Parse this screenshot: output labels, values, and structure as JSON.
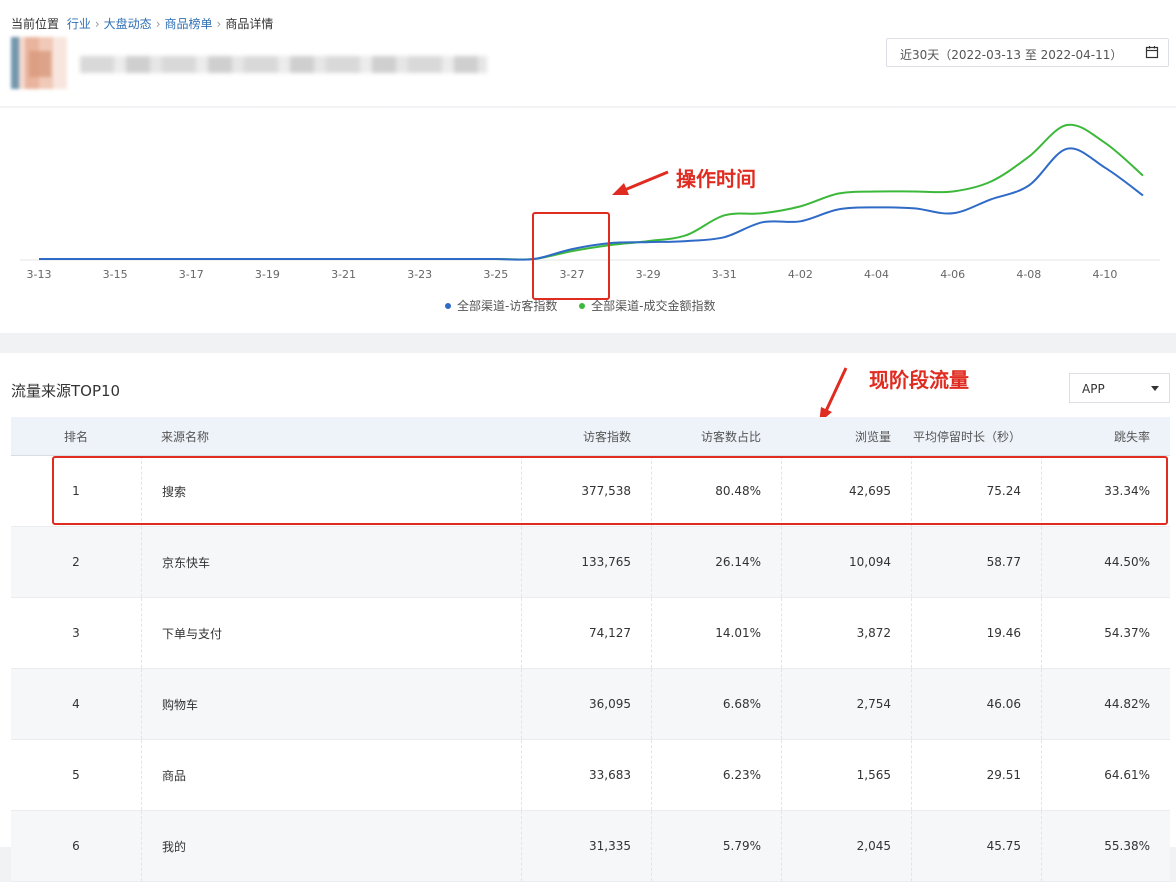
{
  "breadcrumb": {
    "prefix": "当前位置",
    "items": [
      "行业",
      "大盘动态",
      "商品榜单"
    ],
    "current": "商品详情"
  },
  "date_range": "近30天（2022-03-13 至 2022-04-11）",
  "date_icon": "calendar-icon",
  "chart_data": {
    "type": "line",
    "x_ticks": [
      "3-13",
      "3-15",
      "3-17",
      "3-19",
      "3-21",
      "3-23",
      "3-25",
      "3-27",
      "3-29",
      "3-31",
      "4-02",
      "4-04",
      "4-06",
      "4-08",
      "4-10"
    ],
    "x": [
      "3-13",
      "3-14",
      "3-15",
      "3-16",
      "3-17",
      "3-18",
      "3-19",
      "3-20",
      "3-21",
      "3-22",
      "3-23",
      "3-24",
      "3-25",
      "3-26",
      "3-27",
      "3-28",
      "3-29",
      "3-30",
      "3-31",
      "4-01",
      "4-02",
      "4-03",
      "4-04",
      "4-05",
      "4-06",
      "4-07",
      "4-08",
      "4-09",
      "4-10",
      "4-11"
    ],
    "series": [
      {
        "name": "全部渠道-访客指数",
        "color": "#2f6ac6",
        "values": [
          0,
          0,
          0,
          0,
          0,
          0,
          0,
          0,
          0,
          0,
          0,
          0,
          0,
          0,
          10,
          16,
          17,
          18,
          22,
          37,
          38,
          50,
          52,
          51,
          46,
          60,
          74,
          111,
          92,
          64
        ]
      },
      {
        "name": "全部渠道-成交金额指数",
        "color": "#3cb83a",
        "values": [
          0,
          0,
          0,
          0,
          0,
          0,
          0,
          0,
          0,
          0,
          0,
          0,
          0,
          0,
          8,
          14,
          18,
          24,
          44,
          46,
          53,
          66,
          68,
          68,
          68,
          78,
          103,
          135,
          117,
          84
        ]
      }
    ],
    "ylim": [
      0,
      140
    ],
    "grid": false,
    "legend": "bottom-center"
  },
  "annotations": {
    "operation_time": "操作时间",
    "current_traffic": "现阶段流量"
  },
  "traffic": {
    "title": "流量来源TOP10",
    "select_value": "APP",
    "columns": [
      "排名",
      "来源名称",
      "访客指数",
      "访客数占比",
      "浏览量",
      "平均停留时长（秒）",
      "跳失率"
    ],
    "rows": [
      [
        "1",
        "搜索",
        "377,538",
        "80.48%",
        "42,695",
        "75.24",
        "33.34%"
      ],
      [
        "2",
        "京东快车",
        "133,765",
        "26.14%",
        "10,094",
        "58.77",
        "44.50%"
      ],
      [
        "3",
        "下单与支付",
        "74,127",
        "14.01%",
        "3,872",
        "19.46",
        "54.37%"
      ],
      [
        "4",
        "购物车",
        "36,095",
        "6.68%",
        "2,754",
        "46.06",
        "44.82%"
      ],
      [
        "5",
        "商品",
        "33,683",
        "6.23%",
        "1,565",
        "29.51",
        "64.61%"
      ],
      [
        "6",
        "我的",
        "31,335",
        "5.79%",
        "2,045",
        "45.75",
        "55.38%"
      ]
    ]
  }
}
